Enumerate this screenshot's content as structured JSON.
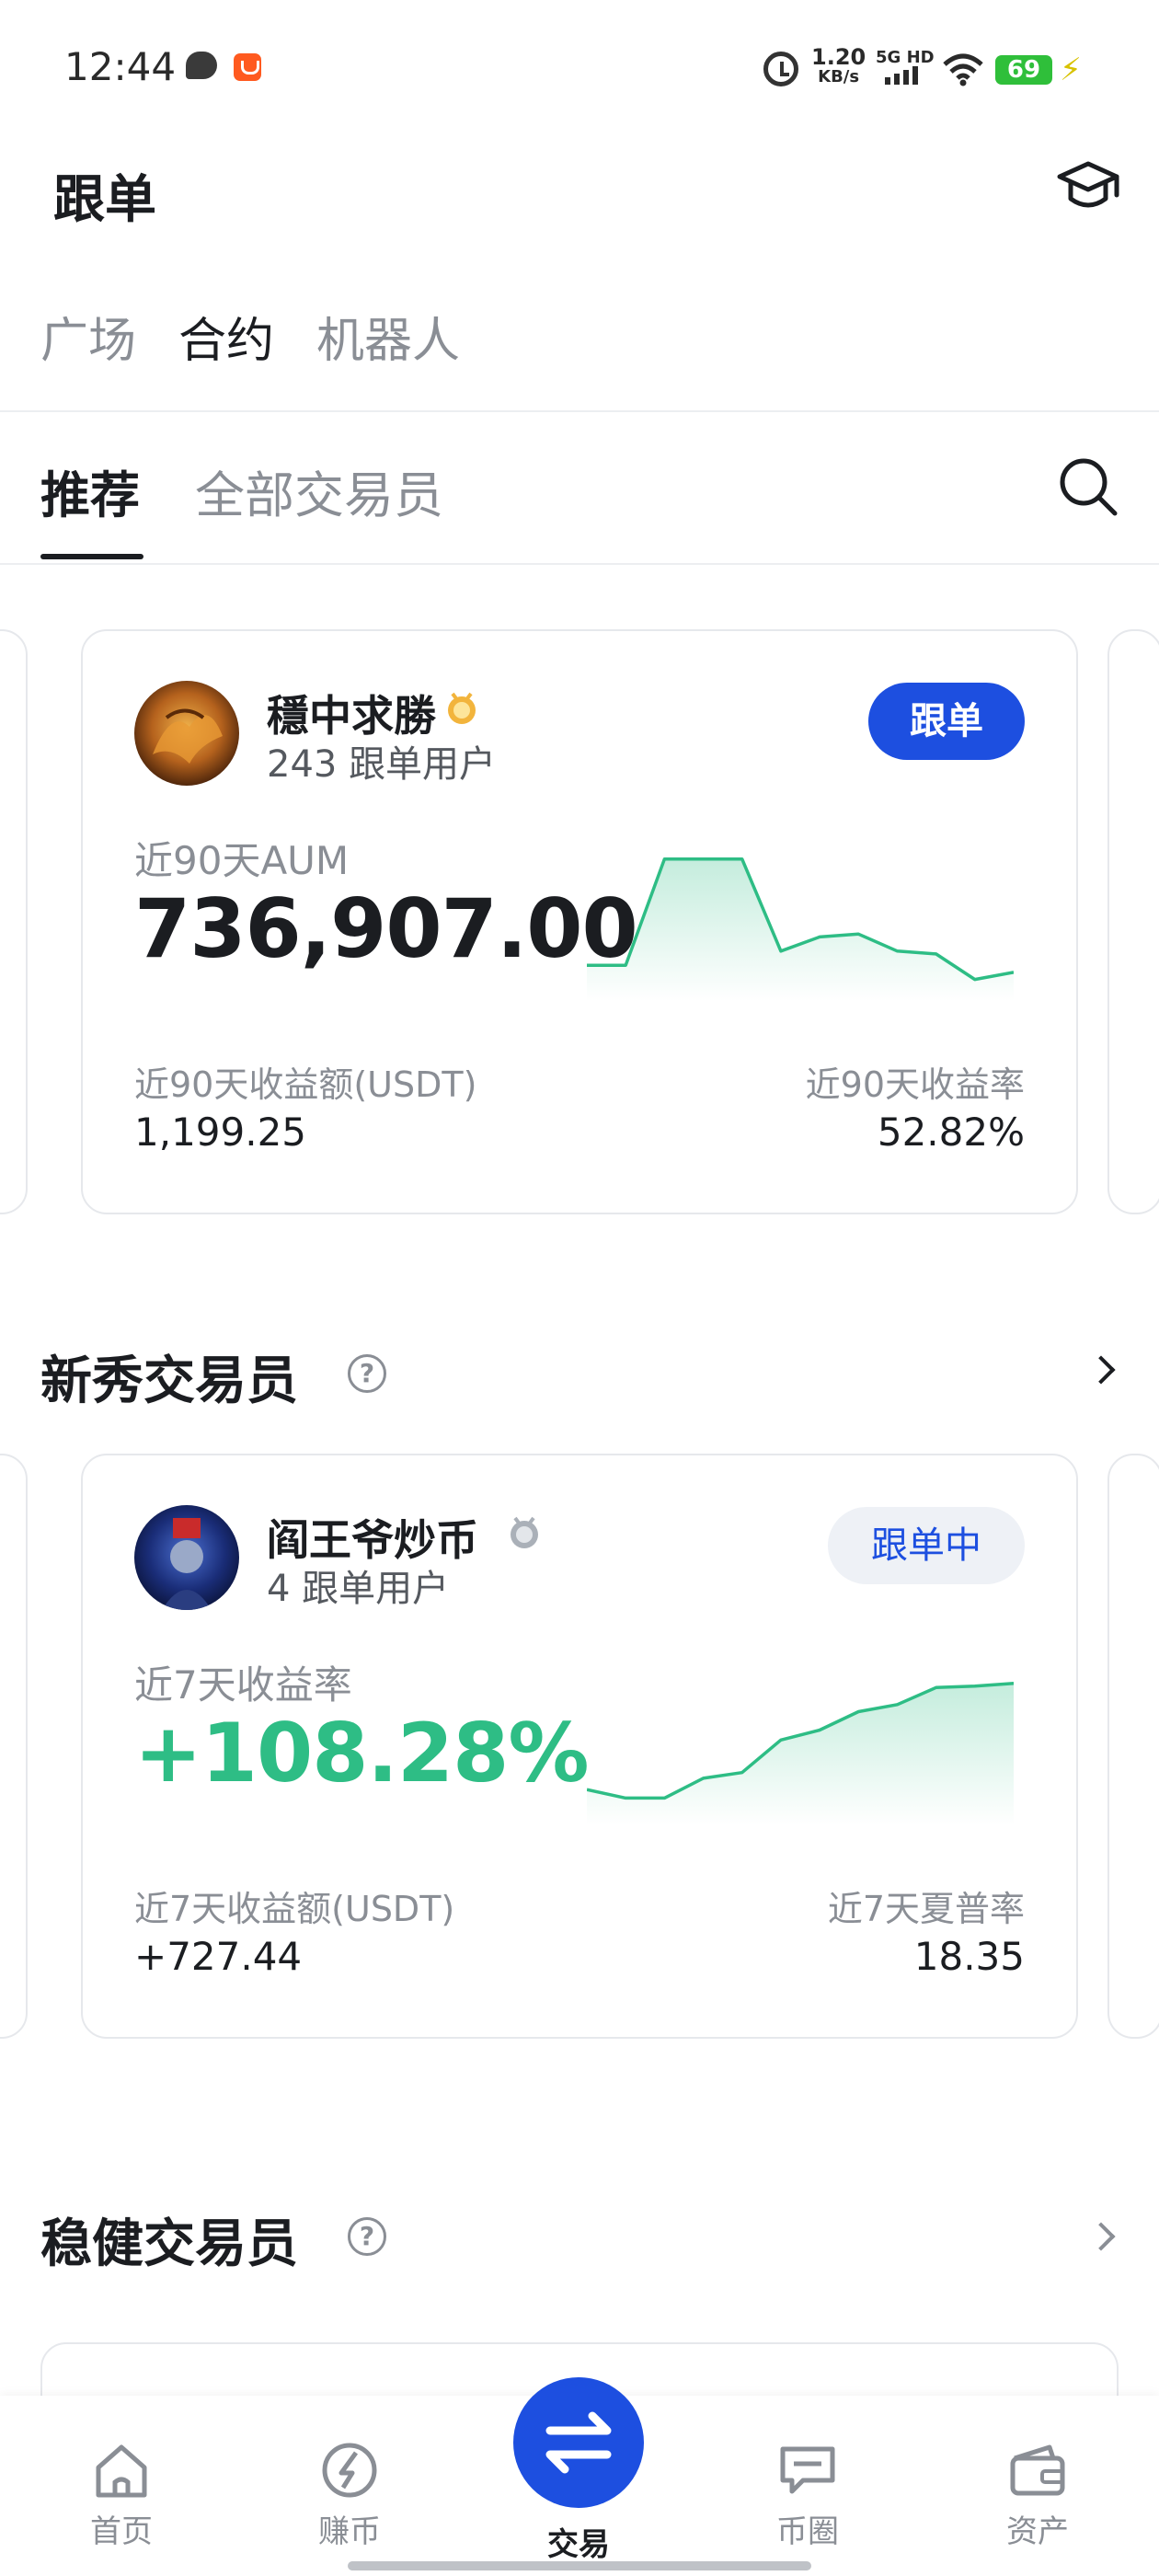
{
  "status_bar": {
    "time": "12:44",
    "net_speed": "1.20",
    "net_speed_unit": "KB/s",
    "network": "5G HD",
    "battery": "69"
  },
  "header": {
    "title": "跟单"
  },
  "sub_tabs": [
    "广场",
    "合约",
    "机器人"
  ],
  "main_tabs": [
    "推荐",
    "全部交易员"
  ],
  "featured_trader": {
    "name": "穩中求勝",
    "followers": "243 跟单用户",
    "button": "跟单",
    "metric_label": "近90天AUM",
    "metric_value": "736,907.00",
    "left_stat_label": "近90天收益额(USDT)",
    "left_stat_value": "1,199.25",
    "right_stat_label": "近90天收益率",
    "right_stat_value": "52.82%",
    "sparkline": [
      0.2,
      0.2,
      0.95,
      0.95,
      0.95,
      0.3,
      0.4,
      0.42,
      0.3,
      0.28,
      0.1,
      0.15
    ]
  },
  "rookie_section": {
    "title": "新秀交易员",
    "help": "?"
  },
  "rookie_trader": {
    "name": "阎王爷炒币",
    "followers": "4 跟单用户",
    "button": "跟单中",
    "metric_label": "近7天收益率",
    "metric_value": "+108.28%",
    "left_stat_label": "近7天收益额(USDT)",
    "left_stat_value": "+727.44",
    "right_stat_label": "近7天夏普率",
    "right_stat_value": "18.35",
    "sparkline": [
      0.2,
      0.14,
      0.14,
      0.28,
      0.32,
      0.55,
      0.62,
      0.75,
      0.8,
      0.92,
      0.93,
      0.95
    ]
  },
  "steady_section": {
    "title": "稳健交易员",
    "help": "?"
  },
  "bottom_nav": [
    {
      "label": "首页",
      "icon": "home-icon"
    },
    {
      "label": "赚币",
      "icon": "earn-icon"
    },
    {
      "label": "交易",
      "icon": "trade-icon"
    },
    {
      "label": "币圈",
      "icon": "chat-icon"
    },
    {
      "label": "资产",
      "icon": "wallet-icon"
    }
  ],
  "colors": {
    "accent_blue": "#1d4fe0",
    "positive_green": "#2ebd85"
  }
}
